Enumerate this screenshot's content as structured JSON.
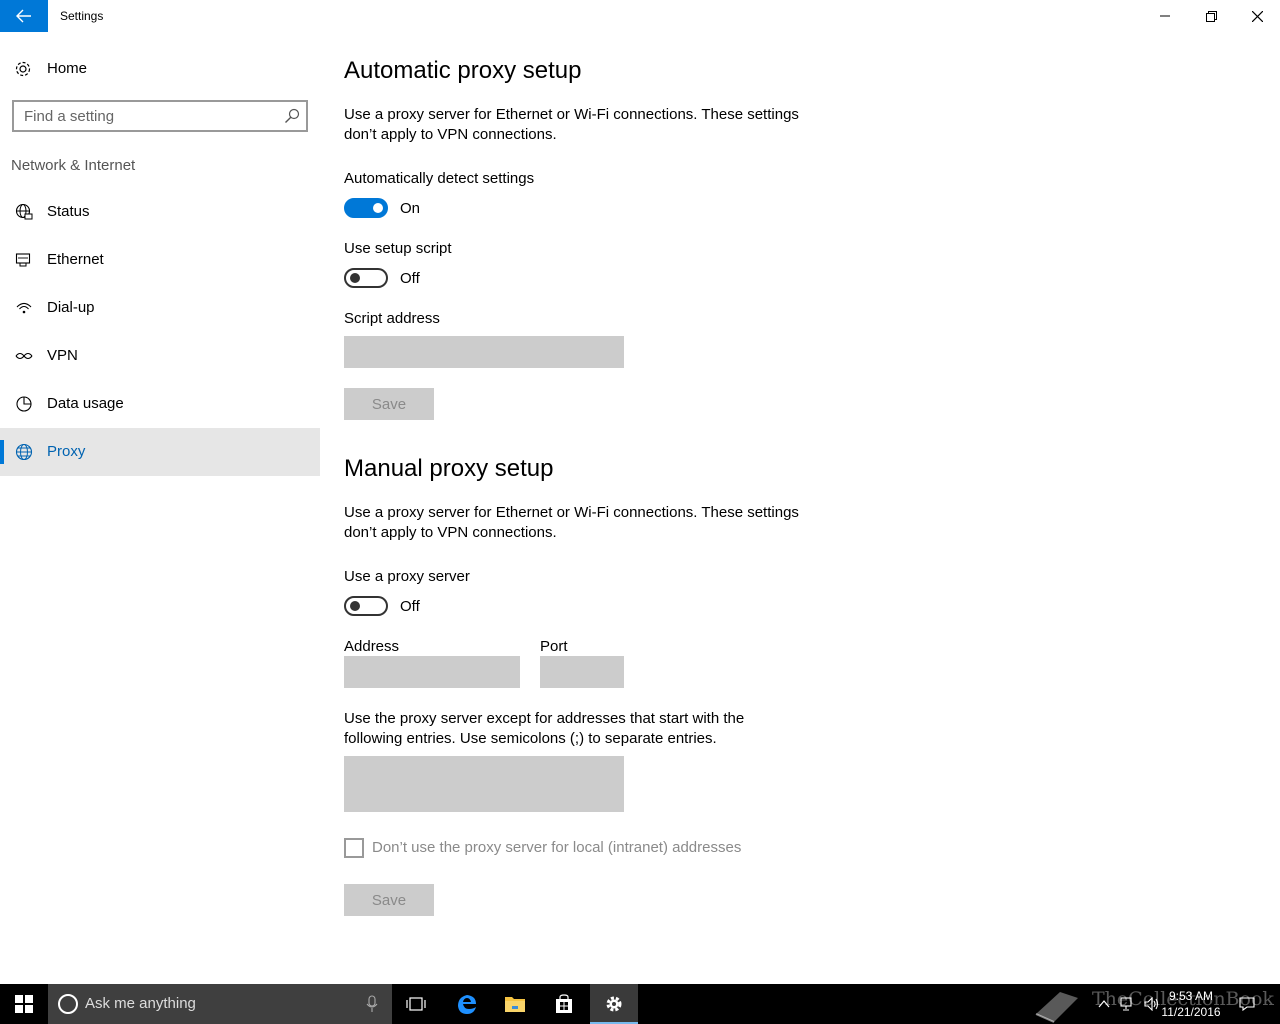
{
  "window": {
    "title": "Settings",
    "controls": {
      "minimize": "minimize",
      "restore": "restore",
      "close": "close"
    }
  },
  "sidebar": {
    "home_label": "Home",
    "search_placeholder": "Find a setting",
    "section_title": "Network & Internet",
    "items": [
      {
        "label": "Status",
        "icon": "globe-network-icon",
        "active": false
      },
      {
        "label": "Ethernet",
        "icon": "ethernet-icon",
        "active": false
      },
      {
        "label": "Dial-up",
        "icon": "dial-up-icon",
        "active": false
      },
      {
        "label": "VPN",
        "icon": "vpn-icon",
        "active": false
      },
      {
        "label": "Data usage",
        "icon": "data-usage-icon",
        "active": false
      },
      {
        "label": "Proxy",
        "icon": "globe-icon",
        "active": true
      }
    ]
  },
  "automatic": {
    "title": "Automatic proxy setup",
    "description": "Use a proxy server for Ethernet or Wi-Fi connections. These settings don’t apply to VPN connections.",
    "detect_label": "Automatically detect settings",
    "detect_state": "On",
    "script_label": "Use setup script",
    "script_state": "Off",
    "script_address_label": "Script address",
    "script_address_value": "",
    "save_label": "Save"
  },
  "manual": {
    "title": "Manual proxy setup",
    "description": "Use a proxy server for Ethernet or Wi-Fi connections. These settings don’t apply to VPN connections.",
    "use_proxy_label": "Use a proxy server",
    "use_proxy_state": "Off",
    "address_label": "Address",
    "address_value": "",
    "port_label": "Port",
    "port_value": "",
    "exceptions_description": "Use the proxy server except for addresses that start with the following entries. Use semicolons (;) to separate entries.",
    "exceptions_value": "",
    "local_checkbox_label": "Don’t use the proxy server for local (intranet) addresses",
    "local_checkbox_checked": false,
    "save_label": "Save"
  },
  "taskbar": {
    "search_placeholder": "Ask me anything",
    "time": "9:53 AM",
    "date": "11/21/2016",
    "watermark": "TheCollectionBook"
  },
  "colors": {
    "accent": "#0078d7",
    "selected_bg": "#e6e6e6",
    "disabled_field": "#cccccc",
    "taskbar": "#000000"
  }
}
